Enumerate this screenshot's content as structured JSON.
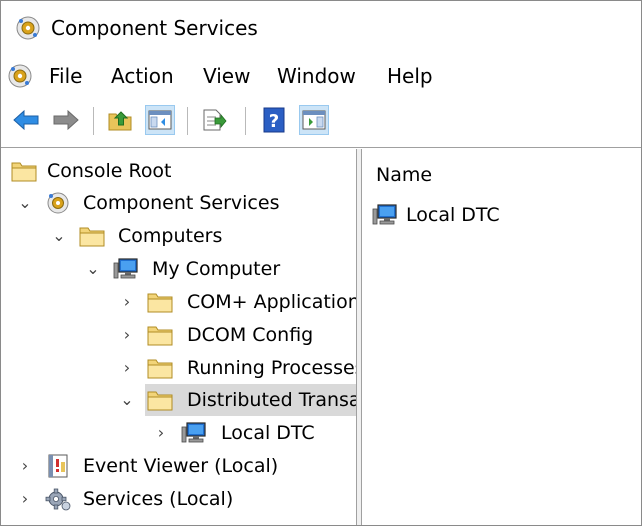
{
  "window": {
    "title": "Component Services"
  },
  "menu": {
    "items": [
      "File",
      "Action",
      "View",
      "Window",
      "Help"
    ]
  },
  "toolbar": {
    "buttons": [
      "back-icon",
      "forward-icon",
      "up-folder-icon",
      "show-hide-tree-icon",
      "export-list-icon",
      "help-icon",
      "show-hide-action-pane-icon"
    ]
  },
  "tree": {
    "items": [
      {
        "label": "Console Root",
        "icon": "folder-icon"
      },
      {
        "label": "Component Services",
        "icon": "component-services-icon",
        "expanded": true
      },
      {
        "label": "Computers",
        "icon": "folder-icon",
        "expanded": true
      },
      {
        "label": "My Computer",
        "icon": "computer-icon",
        "expanded": true
      },
      {
        "label": "COM+ Applications",
        "icon": "folder-icon",
        "expanded": false
      },
      {
        "label": "DCOM Config",
        "icon": "folder-icon",
        "expanded": false
      },
      {
        "label": "Running Processes",
        "icon": "folder-icon",
        "expanded": false
      },
      {
        "label": "Distributed Transaction Coordinator",
        "icon": "folder-icon",
        "expanded": true,
        "selected": true
      },
      {
        "label": "Local DTC",
        "icon": "computer-icon",
        "expanded": false
      },
      {
        "label": "Event Viewer (Local)",
        "icon": "event-viewer-icon",
        "expanded": false
      },
      {
        "label": "Services (Local)",
        "icon": "gear-icon",
        "expanded": false
      }
    ]
  },
  "list": {
    "column_name": "Name",
    "items": [
      {
        "label": "Local DTC",
        "icon": "computer-icon"
      }
    ]
  }
}
